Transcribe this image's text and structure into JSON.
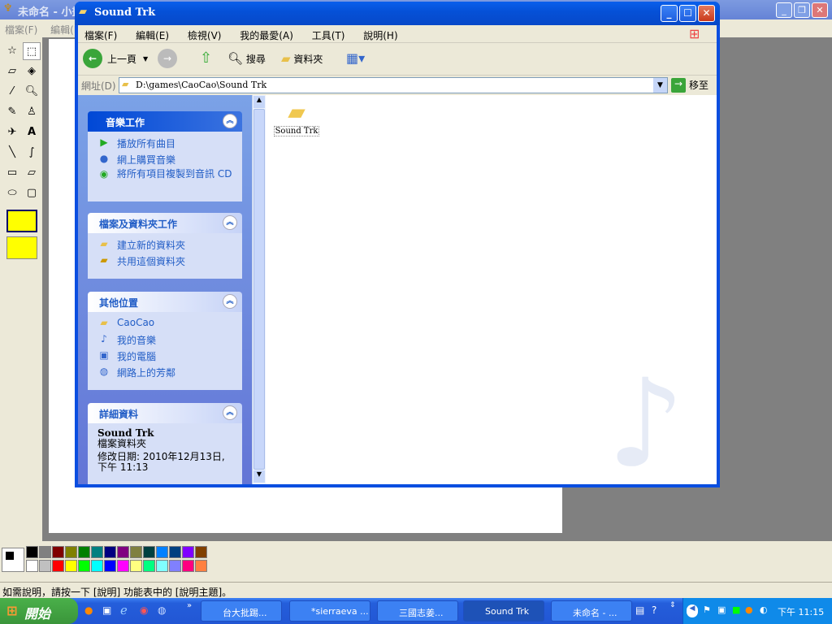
{
  "paint": {
    "title": "未命名 - 小畫家",
    "menu": [
      "檔案(F)",
      "編輯(E)"
    ],
    "status": "如需說明，請按一下 [說明] 功能表中的 [說明主題]。",
    "palette_top": [
      "#000000",
      "#808080",
      "#800000",
      "#808000",
      "#008000",
      "#008080",
      "#000080",
      "#800080",
      "#808040",
      "#004040",
      "#0080ff",
      "#004080",
      "#8000ff",
      "#804000"
    ],
    "palette_bottom": [
      "#ffffff",
      "#c0c0c0",
      "#ff0000",
      "#ffff00",
      "#00ff00",
      "#00ffff",
      "#0000ff",
      "#ff00ff",
      "#ffff80",
      "#00ff80",
      "#80ffff",
      "#8080ff",
      "#ff0080",
      "#ff8040"
    ]
  },
  "explorer": {
    "title": "Sound Trk",
    "menu": [
      "檔案(F)",
      "編輯(E)",
      "檢視(V)",
      "我的最愛(A)",
      "工具(T)",
      "說明(H)"
    ],
    "toolbar": {
      "back": "上一頁",
      "search": "搜尋",
      "folders": "資料夾"
    },
    "address": {
      "label": "網址(D)",
      "value": "D:\\games\\CaoCao\\Sound Trk",
      "go": "移至"
    },
    "panels": [
      {
        "title": "音樂工作",
        "items": [
          {
            "label": "播放所有曲目",
            "icon": "play-icon"
          },
          {
            "label": "網上購買音樂",
            "icon": "globe-icon"
          },
          {
            "label": "將所有項目複製到音訊 CD",
            "icon": "cd-copy-icon"
          }
        ]
      },
      {
        "title": "檔案及資料夾工作",
        "items": [
          {
            "label": "建立新的資料夾",
            "icon": "new-folder-icon"
          },
          {
            "label": "共用這個資料夾",
            "icon": "share-folder-icon"
          }
        ]
      },
      {
        "title": "其他位置",
        "items": [
          {
            "label": "CaoCao",
            "icon": "folder-icon"
          },
          {
            "label": "我的音樂",
            "icon": "music-folder-icon"
          },
          {
            "label": "我的電腦",
            "icon": "computer-icon"
          },
          {
            "label": "網路上的芳鄰",
            "icon": "network-icon"
          }
        ]
      }
    ],
    "details": {
      "title": "詳細資料",
      "name": "Sound Trk",
      "type": "檔案資料夾",
      "modified": "修改日期: 2010年12月13日, 下午 11:13"
    },
    "files": [
      {
        "name": "Sound Trk"
      }
    ]
  },
  "taskbar": {
    "start": "開始",
    "tasks": [
      "台大批踢...",
      "*sierraeva ...",
      "三國志姜...",
      "Sound Trk",
      "未命名 - ..."
    ],
    "clock": "下午 11:15"
  }
}
